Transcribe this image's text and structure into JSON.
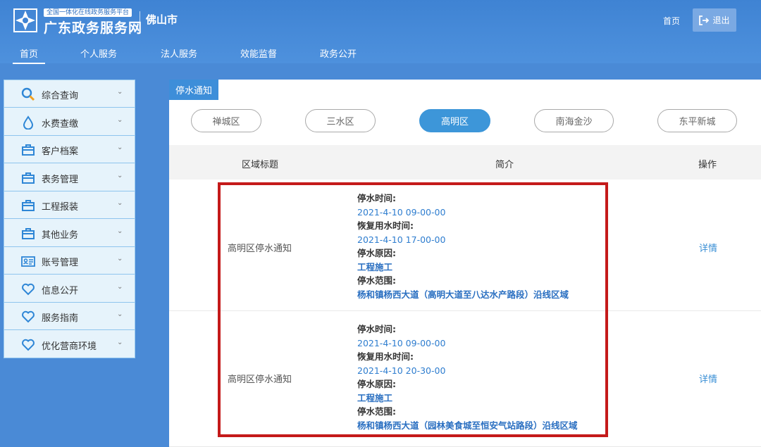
{
  "header": {
    "platform_badge": "全国一体化在线政务服务平台",
    "title": "广东政务服务网",
    "city": "佛山市",
    "home_link": "首页",
    "logout_label": "退出"
  },
  "nav": {
    "items": [
      {
        "label": "首页",
        "active": true
      },
      {
        "label": "个人服务"
      },
      {
        "label": "法人服务"
      },
      {
        "label": "效能监督"
      },
      {
        "label": "政务公开"
      }
    ]
  },
  "sidebar": {
    "items": [
      {
        "label": "综合查询",
        "icon": "search-icon"
      },
      {
        "label": "水费查缴",
        "icon": "water-drop-icon"
      },
      {
        "label": "客户档案",
        "icon": "briefcase-icon"
      },
      {
        "label": "表务管理",
        "icon": "briefcase-icon"
      },
      {
        "label": "工程报装",
        "icon": "briefcase-icon"
      },
      {
        "label": "其他业务",
        "icon": "briefcase-icon"
      },
      {
        "label": "账号管理",
        "icon": "id-card-icon"
      },
      {
        "label": "信息公开",
        "icon": "heart-icon"
      },
      {
        "label": "服务指南",
        "icon": "heart-icon"
      },
      {
        "label": "优化营商环境",
        "icon": "heart-icon"
      }
    ]
  },
  "panel": {
    "tag": "停水通知",
    "districts": [
      {
        "label": "禅城区"
      },
      {
        "label": "三水区"
      },
      {
        "label": "高明区",
        "active": true
      },
      {
        "label": "南海金沙"
      },
      {
        "label": "东平新城"
      }
    ],
    "columns": {
      "title": "区域标题",
      "intro": "简介",
      "action": "操作"
    },
    "rows": [
      {
        "title": "高明区停水通知",
        "stop_time_label": "停水时间:",
        "stop_time": "2021-4-10 09-00-00",
        "resume_time_label": "恢复用水时间:",
        "resume_time": "2021-4-10 17-00-00",
        "reason_label": "停水原因:",
        "reason": "工程施工",
        "scope_label": "停水范围:",
        "scope": "杨和镇杨西大道（高明大道至八达水产路段）沿线区域",
        "action": "详情"
      },
      {
        "title": "高明区停水通知",
        "stop_time_label": "停水时间:",
        "stop_time": "2021-4-10 09-00-00",
        "resume_time_label": "恢复用水时间:",
        "resume_time": "2021-4-10 20-30-00",
        "reason_label": "停水原因:",
        "reason": "工程施工",
        "scope_label": "停水范围:",
        "scope": "杨和镇杨西大道（园林美食城至恒安气站路段）沿线区域",
        "action": "详情"
      }
    ]
  },
  "colors": {
    "header_blue": "#3f83d3",
    "accent_blue": "#3d96d9",
    "highlight_red": "#c41a1a"
  }
}
